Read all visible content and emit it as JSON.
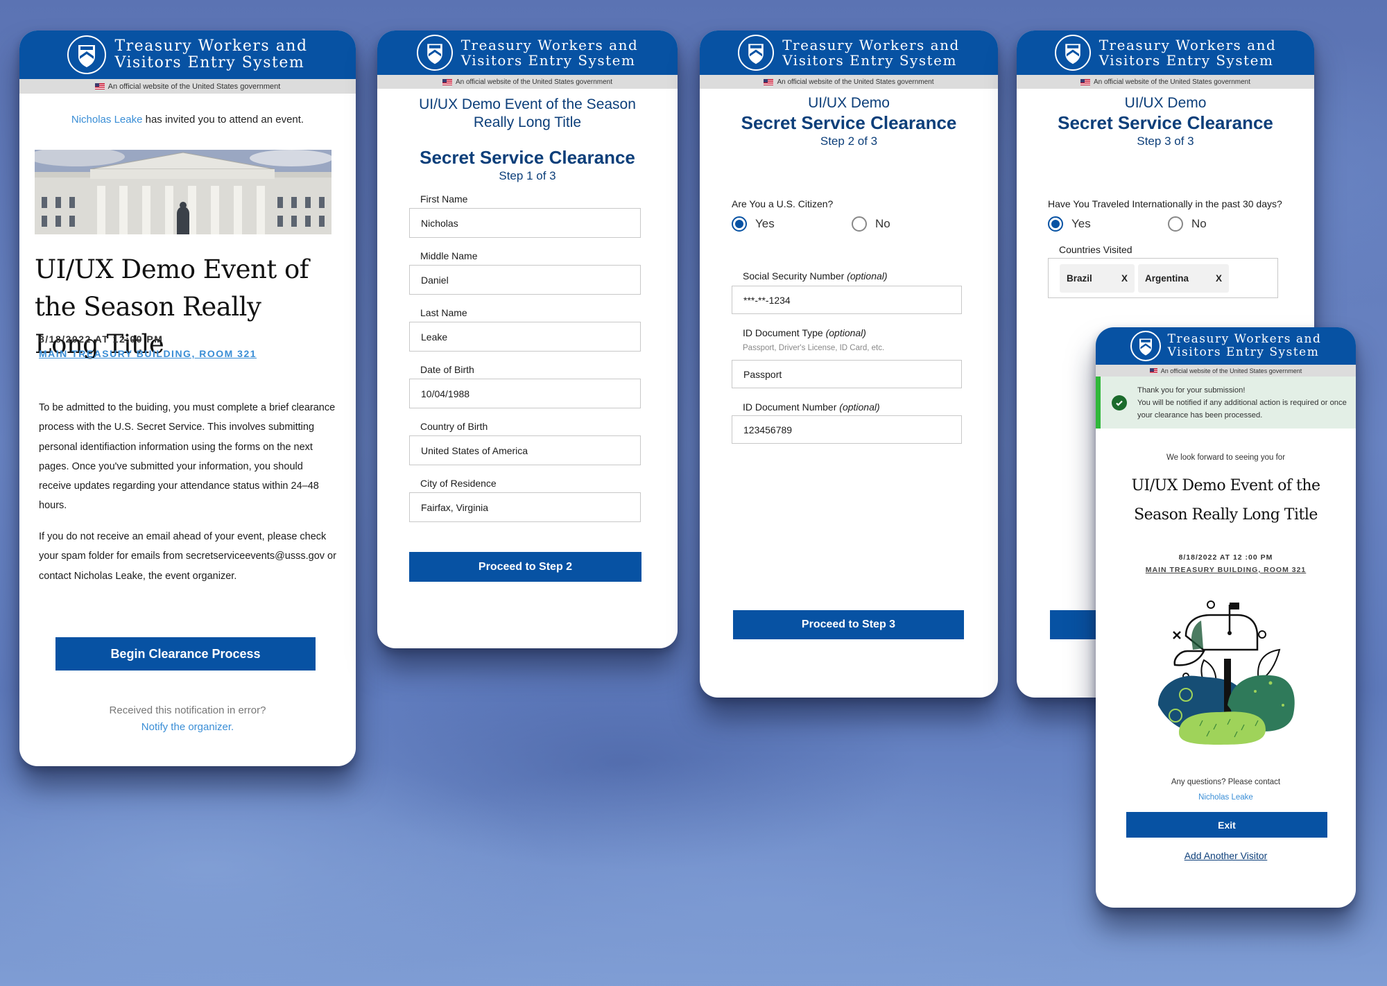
{
  "brand": {
    "title_line1": "Treasury Workers and",
    "title_line2": "Visitors Entry System",
    "gov_banner": "An official website of the United States government",
    "colors": {
      "primary": "#0752a3",
      "heading": "#0d3f7a",
      "link": "#3a8ed6",
      "success": "#2e9c3a",
      "success_bg": "#e3efe6"
    }
  },
  "invite": {
    "organizer_name": "Nicholas Leake",
    "invite_text": " has invited you to attend an event.",
    "image_alt": "Treasury building photo",
    "event_title": "UI/UX Demo Event of the Season Really Long Title",
    "datetime": "8/18/2022 AT 12:00 PM",
    "location": "MAIN TREASURY BUILDING, ROOM 321",
    "paragraph1": "To be admitted to the buiding, you must complete a brief clearance process with the U.S. Secret Service. This involves submitting personal identifiaction information using the forms on the next pages. Once you've submitted your information, you should receive updates regarding your attendance status within 24–48 hours.",
    "paragraph2": "If you do not receive an email ahead of your event, please check your spam folder for emails from secretserviceevents@usss.gov or contact Nicholas Leake, the event organizer.",
    "begin_button": "Begin Clearance Process",
    "error_text": "Received this notification in error?",
    "notify_link": "Notify the organizer."
  },
  "step1": {
    "event_title": "UI/UX Demo Event of the Season Really Long Title",
    "heading": "Secret Service Clearance",
    "step": "Step 1 of 3",
    "fields": [
      {
        "label": "First Name",
        "value": "Nicholas"
      },
      {
        "label": "Middle Name",
        "value": "Daniel"
      },
      {
        "label": "Last Name",
        "value": "Leake"
      },
      {
        "label": "Date of Birth",
        "value": "10/04/1988"
      },
      {
        "label": "Country of Birth",
        "value": "United States of America"
      },
      {
        "label": "City of Residence",
        "value": "Fairfax, Virginia"
      }
    ],
    "button": "Proceed to Step 2"
  },
  "step2": {
    "event_title": "UI/UX Demo",
    "heading": "Secret Service Clearance",
    "step": "Step 2 of 3",
    "question": "Are You a U.S. Citizen?",
    "options": [
      {
        "label": "Yes",
        "selected": true
      },
      {
        "label": "No",
        "selected": false
      }
    ],
    "ssn_label": "Social Security Number",
    "ssn_value": "***-**-1234",
    "doc_type_label": "ID Document Type",
    "doc_type_hint": "Passport, Driver's License, ID Card, etc.",
    "doc_type_value": "Passport",
    "doc_num_label": "ID Document Number",
    "doc_num_value": "123456789",
    "optional": "(optional)",
    "button": "Proceed to Step 3"
  },
  "step3": {
    "event_title": "UI/UX Demo",
    "heading": "Secret Service Clearance",
    "step": "Step 3 of 3",
    "question": "Have You Traveled Internationally in the past 30 days?",
    "options": [
      {
        "label": "Yes",
        "selected": true
      },
      {
        "label": "No",
        "selected": false
      }
    ],
    "countries_label": "Countries Visited",
    "countries": [
      {
        "name": "Brazil",
        "remove": "X"
      },
      {
        "name": "Argentina",
        "remove": "X"
      }
    ]
  },
  "confirm": {
    "alert_line1": "Thank you for your submission!",
    "alert_line2": "You will be notified if any additional action is required or once your clearance has been processed.",
    "lead": "We look forward to seeing you for",
    "event_title": "UI/UX Demo Event of the Season Really Long Title",
    "datetime": "8/18/2022 AT 12 :00 PM",
    "location": "MAIN TREASURY BUILDING, ROOM 321",
    "contact_text": "Any questions? Please contact",
    "contact_name": "Nicholas Leake",
    "exit_button": "Exit",
    "add_visitor": "Add Another Visitor"
  }
}
